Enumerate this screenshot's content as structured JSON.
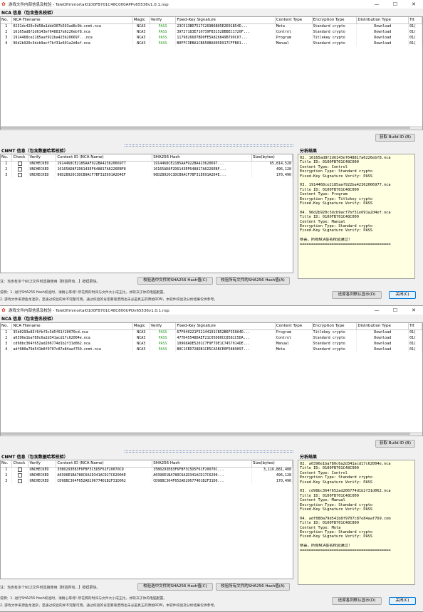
{
  "windows": [
    {
      "title": "游戏文件内部信息及校验 - TaleOfImmortal0100FB701C48C000APPv65536v1.0.1.nsp",
      "nca_section_label": "NCA 信息（包含签名校验）",
      "nca_columns": [
        "No.",
        "NCA Filename",
        "Magic",
        "Verify",
        "Fixed-Key Signature",
        "Content Type",
        "Encryption Type",
        "Distribution Type",
        "Tit"
      ],
      "nca_rows": [
        [
          "1",
          "0231dc420c0d58a1ddd307b563ad8c0b.cnmt.nca",
          "NCA3",
          "PASS",
          "23C513BD7517C269B6B05E2E01B54D...",
          "Meta",
          "Standard crypto",
          "Download",
          "01("
        ],
        [
          "2",
          "16165ad8f2d6143ef648817a6226ebf8.nca",
          "NCA3",
          "PASS",
          "39727183E710739FB31528BBEC1720F...",
          "Control",
          "Standard crypto",
          "Download",
          "01("
        ],
        [
          "3",
          "1914468ce2185aaf922ba4236206697...nca",
          "NCA3",
          "PASS",
          "1179826607BD0FE5A826849B799C07...",
          "Program",
          "Titlekey crypto",
          "Download",
          "01("
        ],
        [
          "4",
          "96d2b920c3dcb9acf7bf31e691a2d4ef.nca",
          "NCA3",
          "PASS",
          "B0FFC3EBA1CB650BA005D917CFFB01...",
          "Manual",
          "Standard crypto",
          "Download",
          "01("
        ]
      ],
      "build_id_button": "获取 Build ID (B)",
      "cnmt_section_label": "CNMT 信息（包含数据哈希校验）",
      "cnmt_columns": [
        "No.",
        "Check",
        "Verify",
        "Content ID (NCA Name)",
        "SHA256 Hash",
        "Size(bytes)"
      ],
      "cnmt_rows": [
        [
          "1",
          "",
          "UNCHECKED",
          "1914468CE2185AAF922BA42362066977",
          "1914468CE2185AAF922BA423620697...",
          "65,814,528"
        ],
        [
          "2",
          "",
          "UNCHECKED",
          "16165AD8F2D6143EF648817A6226EBF8",
          "16165AD8F2D6143EF648817A6226EBF...",
          "496,128"
        ],
        [
          "3",
          "",
          "UNCHECKED",
          "96D2B920C3DCB9ACF7BF31E691A2D4EF",
          "96D2B920C3DCB9ACF7BF31E691A2D4E...",
          "170,496"
        ]
      ],
      "result_label": "分析结果",
      "result_lines": [
        "02. 16165ad8f2d6143ef648817a6226ebf8.nca",
        "Title ID: 0100FB701C48C000",
        "Content Type: Control",
        "Encryption Type: Standard crypto",
        "Fixed-Key Signature Verify: PASS",
        "",
        "03. 1914468ce2185aaf922ba42362066977.nca",
        "Title ID: 0100FB701C48C000",
        "Content Type: Program",
        "Encryption Type: Titlekey crypto",
        "Fixed-Key Signature Verify: PASS",
        "",
        "04. 96d2b920c3dcb9acf7bf31e691a2d4ef.nca",
        "Title ID: 0100FB701C48C000",
        "Content Type: Manual",
        "Encryption Type: Standard crypto",
        "Fixed-Key Signature Verify: PASS",
        "",
        "恭喜，所有NCA签名校验通过！",
        "========================================"
      ],
      "hint_text": "注：当含有多个NCZ文件时直接使用【校验所有...】按钮更快。",
      "verify_selected_button": "校验选中文件的SHA256 Hash值(C)",
      "verify_all_button": "校验所有文件的SHA256 Hash值(A)",
      "note_line1": "说明：1. 进行SHA256 Hash校验时，请耐心等待! 所花费的时间与文件大小成正比，并取决于你的电脑配置。",
      "note_line2": "      2. 游戏文件来源鱼龙混杂，至通过校验的并不完整可用，通过校验的肯定要靠谱而也未必是真正的原始ROM，本软件校验及分析结果仅供参考。",
      "restore_button": "还原各列默认显示(D)",
      "close_button": "关闭(C)"
    },
    {
      "title": "游戏文件内部信息及校验 - TaleOfImmortal0100FB701C48C800UPDv65536v1.0.1.nsp",
      "nca_section_label": "NCA 信息（包含签名校验）",
      "nca_columns": [
        "No.",
        "NCA Filename",
        "Magic",
        "Verify",
        "Fixed-Key Signature",
        "Content Type",
        "Encryption Type",
        "Distribution Type",
        "Tit"
      ],
      "nca_rows": [
        [
          "1",
          "35b0293e83f6fbf3c5d5f61f20070cd.nca",
          "NCA3",
          "PASS",
          "67F040221F52144191CB52B6F350A4D...",
          "Program",
          "Titlekey crypto",
          "Download",
          "01("
        ],
        [
          "2",
          "a0396e1ba780c6a2d341acd17c62004e.nca",
          "NCA3",
          "PASS",
          "477D45548DAEF21C05D80CC8581C5DA...",
          "Control",
          "Standard crypto",
          "Download",
          "01("
        ],
        [
          "3",
          "cd98bc364f652ad206774d1b2f31d062.nca",
          "NCA3",
          "PASS",
          "10968ADE5201C7F9F7DE1C7457914DE...",
          "Manual",
          "Standard crypto",
          "Download",
          "01("
        ],
        [
          "4",
          "adf080a79d541b8f9707c87e84aaf769.cnmt.nca",
          "NCA3",
          "PASS",
          "B0C15ED728DB1CE5CA5BCE0F5889097...",
          "Meta",
          "Standard crypto",
          "Download",
          "01("
        ]
      ],
      "build_id_button": "获取 Build ID (B)",
      "cnmt_section_label": "CNMT 信息（包含数据哈希校验）",
      "cnmt_columns": [
        "No.",
        "Check",
        "Verify",
        "Content ID (NCA Name)",
        "SHA256 Hash",
        "Size(bytes)"
      ],
      "cnmt_rows": [
        [
          "1",
          "",
          "UNCHECKED",
          "35B0293E83F6FBF3C5D5F61F20070CD",
          "35B0293E83F6FBF3C5D5F61F20070C...",
          "3,116,881,408"
        ],
        [
          "2",
          "",
          "UNCHECKED",
          "A0396E1BA780C6A2D341ACD17C62004E",
          "A0396E1BA780C6A2D341ACD17C6200...",
          "496,128"
        ],
        [
          "3",
          "",
          "UNCHECKED",
          "CD98BC364F652AD206774D1B2F31D062",
          "CD98BC364F652AD206774D1B2F31D0...",
          "170,496"
        ]
      ],
      "result_label": "分析结果",
      "result_lines": [
        "02. a0396e1ba780c6a2d341acd17c62004e.nca",
        "Title ID: 0100FB701C48C000",
        "Content Type: Control",
        "Encryption Type: Standard crypto",
        "Fixed-Key Signature Verify: PASS",
        "",
        "03. cd98bc364f652ad206774d1b2f31d062.nca",
        "Title ID: 0100FB701C48C000",
        "Content Type: Manual",
        "Encryption Type: Standard crypto",
        "Fixed-Key Signature Verify: PASS",
        "",
        "04. adf080a79d541b8f9707c87e84aaf769.cnm",
        "Title ID: 0100FB701C48C800",
        "Content Type: Meta",
        "Encryption Type: Standard crypto",
        "Fixed-Key Signature Verify: PASS",
        "",
        "恭喜，所有NCA签名校验通过！",
        "========================================"
      ],
      "hint_text": "注：当含有多个NCZ文件时直接使用【校验所有...】按钮更快。",
      "verify_selected_button": "校验选中文件的SHA256 Hash值(C)",
      "verify_all_button": "校验所有文件的SHA256 Hash值(A)",
      "note_line1": "说明：1. 进行SHA256 Hash校验时，请耐心等待! 所花费的时间与文件大小成正比，并取决于你的电脑配置。",
      "note_line2": "      2. 游戏文件来源鱼龙混杂，至通过校验的并不完整可用，通过校验的肯定要靠谱而也未必是真正的原始ROM，本软件校验及分析结果仅供参考。",
      "restore_button": "还原各列默认显示(D)",
      "close_button": "关闭(C)"
    }
  ],
  "window_controls": {
    "minimize": "—",
    "maximize": "☐",
    "close": "✕"
  },
  "colors": {
    "pass": "#1d9a1d",
    "result_bg": "#ffffe1",
    "focus_border": "#0078d7",
    "app_icon": "#d63b2a"
  }
}
